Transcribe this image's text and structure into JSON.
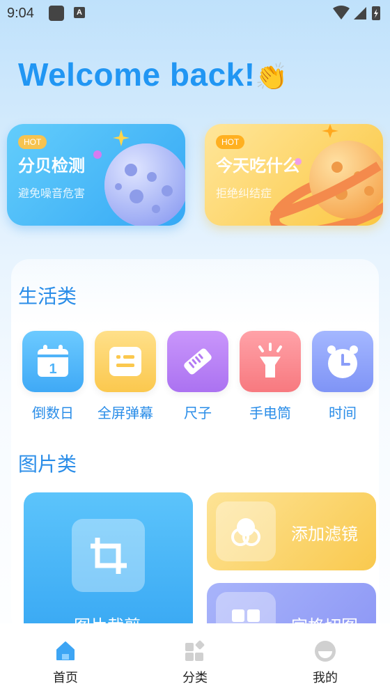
{
  "status_bar": {
    "time": "9:04",
    "notification_a": "A"
  },
  "header": {
    "welcome_text": "Welcome back!",
    "wave_emoji": "👏"
  },
  "banners": [
    {
      "badge": "HOT",
      "title": "分贝检测",
      "subtitle": "避免噪音危害",
      "icon": "moon-planet-illustration"
    },
    {
      "badge": "HOT",
      "title": "今天吃什么",
      "subtitle": "拒绝纠结症",
      "icon": "ringed-planet-illustration"
    }
  ],
  "life_section": {
    "title": "生活类",
    "tools": [
      {
        "label": "倒数日",
        "icon": "calendar-icon",
        "color": "#5ab8fb"
      },
      {
        "label": "全屏弹幕",
        "icon": "message-icon",
        "color": "#fbcf5c"
      },
      {
        "label": "尺子",
        "icon": "ruler-icon",
        "color": "#bb86f6"
      },
      {
        "label": "手电筒",
        "icon": "flashlight-icon",
        "color": "#fa8a92"
      },
      {
        "label": "时间",
        "icon": "clock-icon",
        "color": "#8aa2fb"
      }
    ]
  },
  "image_section": {
    "title": "图片类",
    "tiles": [
      {
        "label": "图片裁剪",
        "icon": "crop-icon"
      },
      {
        "label": "添加滤镜",
        "icon": "filter-icon"
      },
      {
        "label": "宫格切图",
        "icon": "grid-icon"
      }
    ]
  },
  "bottom_nav": {
    "items": [
      {
        "label": "首页",
        "icon": "home-icon",
        "active": true
      },
      {
        "label": "分类",
        "icon": "category-icon",
        "active": false
      },
      {
        "label": "我的",
        "icon": "profile-icon",
        "active": false
      }
    ]
  },
  "colors": {
    "accent": "#2196f3",
    "section_text": "#2a8de8"
  }
}
